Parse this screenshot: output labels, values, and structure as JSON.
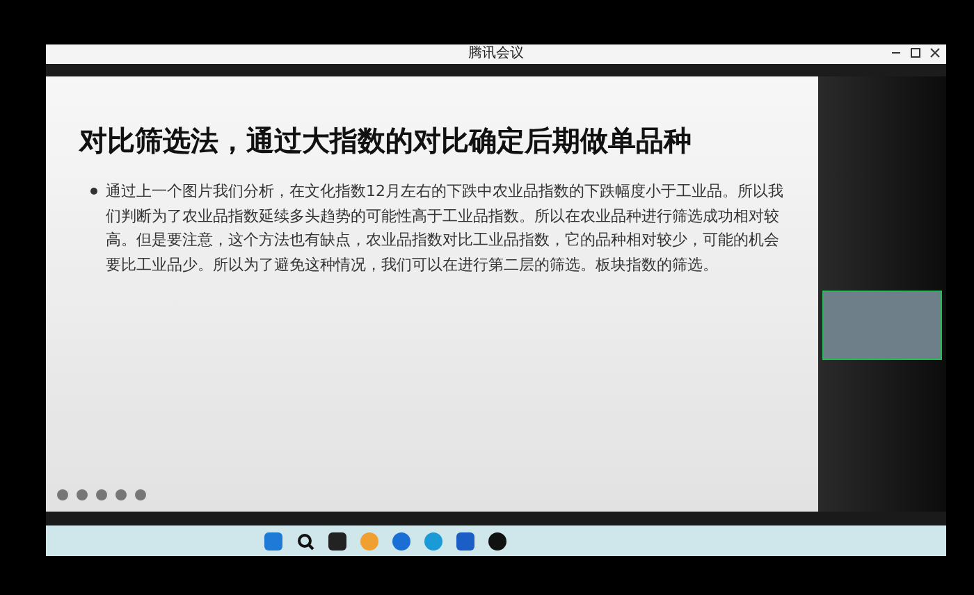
{
  "window": {
    "title": "腾讯会议"
  },
  "slide": {
    "title": "对比筛选法，通过大指数的对比确定后期做单品种",
    "bullets": [
      "通过上一个图片我们分析，在文化指数12月左右的下跌中农业品指数的下跌幅度小于工业品。所以我们判断为了农业品指数延续多头趋势的可能性高于工业品指数。所以在农业品种进行筛选成功相对较高。但是要注意，这个方法也有缺点，农业品指数对比工业品指数，它的品种相对较少，可能的机会要比工业品少。所以为了避免这种情况，我们可以在进行第二层的筛选。板块指数的筛选。"
    ]
  }
}
